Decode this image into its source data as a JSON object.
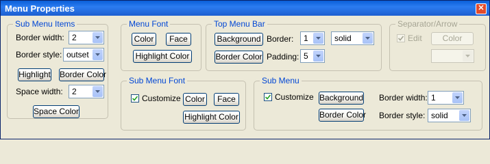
{
  "window": {
    "title": "Menu Properties",
    "close_icon": "close-icon"
  },
  "sub_menu_items": {
    "legend": "Sub Menu Items",
    "border_width_label": "Border width:",
    "border_width_value": "2",
    "border_style_label": "Border style:",
    "border_style_value": "outset",
    "highlight_button": "Highlight",
    "border_color_button": "Border Color",
    "space_width_label": "Space width:",
    "space_width_value": "2",
    "space_color_button": "Space Color"
  },
  "menu_font": {
    "legend": "Menu Font",
    "color_button": "Color",
    "face_button": "Face",
    "highlight_color_button": "Highlight Color"
  },
  "top_menu_bar": {
    "legend": "Top Menu Bar",
    "background_button": "Background",
    "border_label": "Border:",
    "border_value": "1",
    "border_style_value": "solid",
    "border_color_button": "Border Color",
    "padding_label": "Padding:",
    "padding_value": "5"
  },
  "separator_arrow": {
    "legend": "Separator/Arrow",
    "edit_label": "Edit",
    "edit_checked": true,
    "color_button": "Color",
    "select_value": ""
  },
  "sub_menu_font": {
    "legend": "Sub Menu Font",
    "customize_label": "Customize",
    "customize_checked": true,
    "color_button": "Color",
    "face_button": "Face",
    "highlight_color_button": "Highlight Color"
  },
  "sub_menu": {
    "legend": "Sub Menu",
    "customize_label": "Customize",
    "customize_checked": true,
    "background_button": "Background",
    "border_color_button": "Border Color",
    "border_width_label": "Border width:",
    "border_width_value": "1",
    "border_style_label": "Border style:",
    "border_style_value": "solid"
  }
}
